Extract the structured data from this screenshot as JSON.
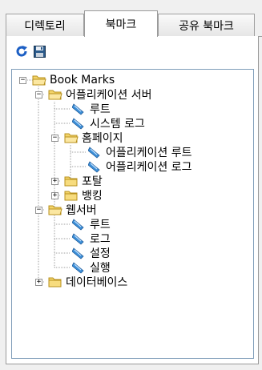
{
  "tabs": [
    {
      "label": "디렉토리",
      "active": false
    },
    {
      "label": "북마크",
      "active": true
    },
    {
      "label": "공유 북마크",
      "active": false
    }
  ],
  "toolbar": {
    "refresh_icon": "refresh-icon",
    "save_icon": "save-icon"
  },
  "tree": {
    "root": "Book Marks",
    "app_server": "어플리케이션 서버",
    "root_item": "루트",
    "system_log": "시스템 로그",
    "homepage": "홈페이지",
    "app_root": "어플리케이션 루트",
    "app_log": "어플리케이션 로그",
    "portal": "포탈",
    "banking": "뱅킹",
    "web_server": "웹서버",
    "ws_root": "루트",
    "ws_log": "로그",
    "ws_config": "설정",
    "ws_run": "실행",
    "database": "데이터베이스"
  },
  "colors": {
    "folder": "#f3d46a",
    "folder_edge": "#b8921e",
    "page_blue": "#3c8fd8"
  }
}
